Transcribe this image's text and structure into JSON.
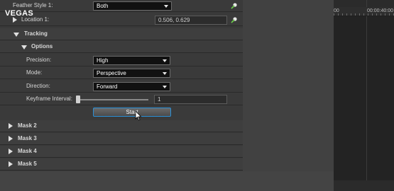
{
  "app": {
    "logo_text": "VEGAS"
  },
  "rows": {
    "feather_style": {
      "label": "Feather Style 1:",
      "value": "Both"
    },
    "location": {
      "label": "Location 1:",
      "value": "0.506, 0.629"
    }
  },
  "sections": {
    "tracking": "Tracking",
    "options": "Options",
    "mask2": "Mask 2",
    "mask3": "Mask 3",
    "mask4": "Mask 4",
    "mask5": "Mask 5"
  },
  "options": {
    "precision": {
      "label": "Precision:",
      "value": "High"
    },
    "mode": {
      "label": "Mode:",
      "value": "Perspective"
    },
    "direction": {
      "label": "Direction:",
      "value": "Forward"
    },
    "keyframe_interval": {
      "label": "Keyframe Interval:",
      "value": "1",
      "slider_fraction": 0.0
    },
    "start_button": "Start"
  },
  "timeline": {
    "ruler_label_1": "00",
    "ruler_label_2": "00:00:40:00"
  },
  "colors": {
    "accent": "#2a8fd6",
    "panel": "#3a3a3a",
    "timeline": "#2b2b2b"
  }
}
